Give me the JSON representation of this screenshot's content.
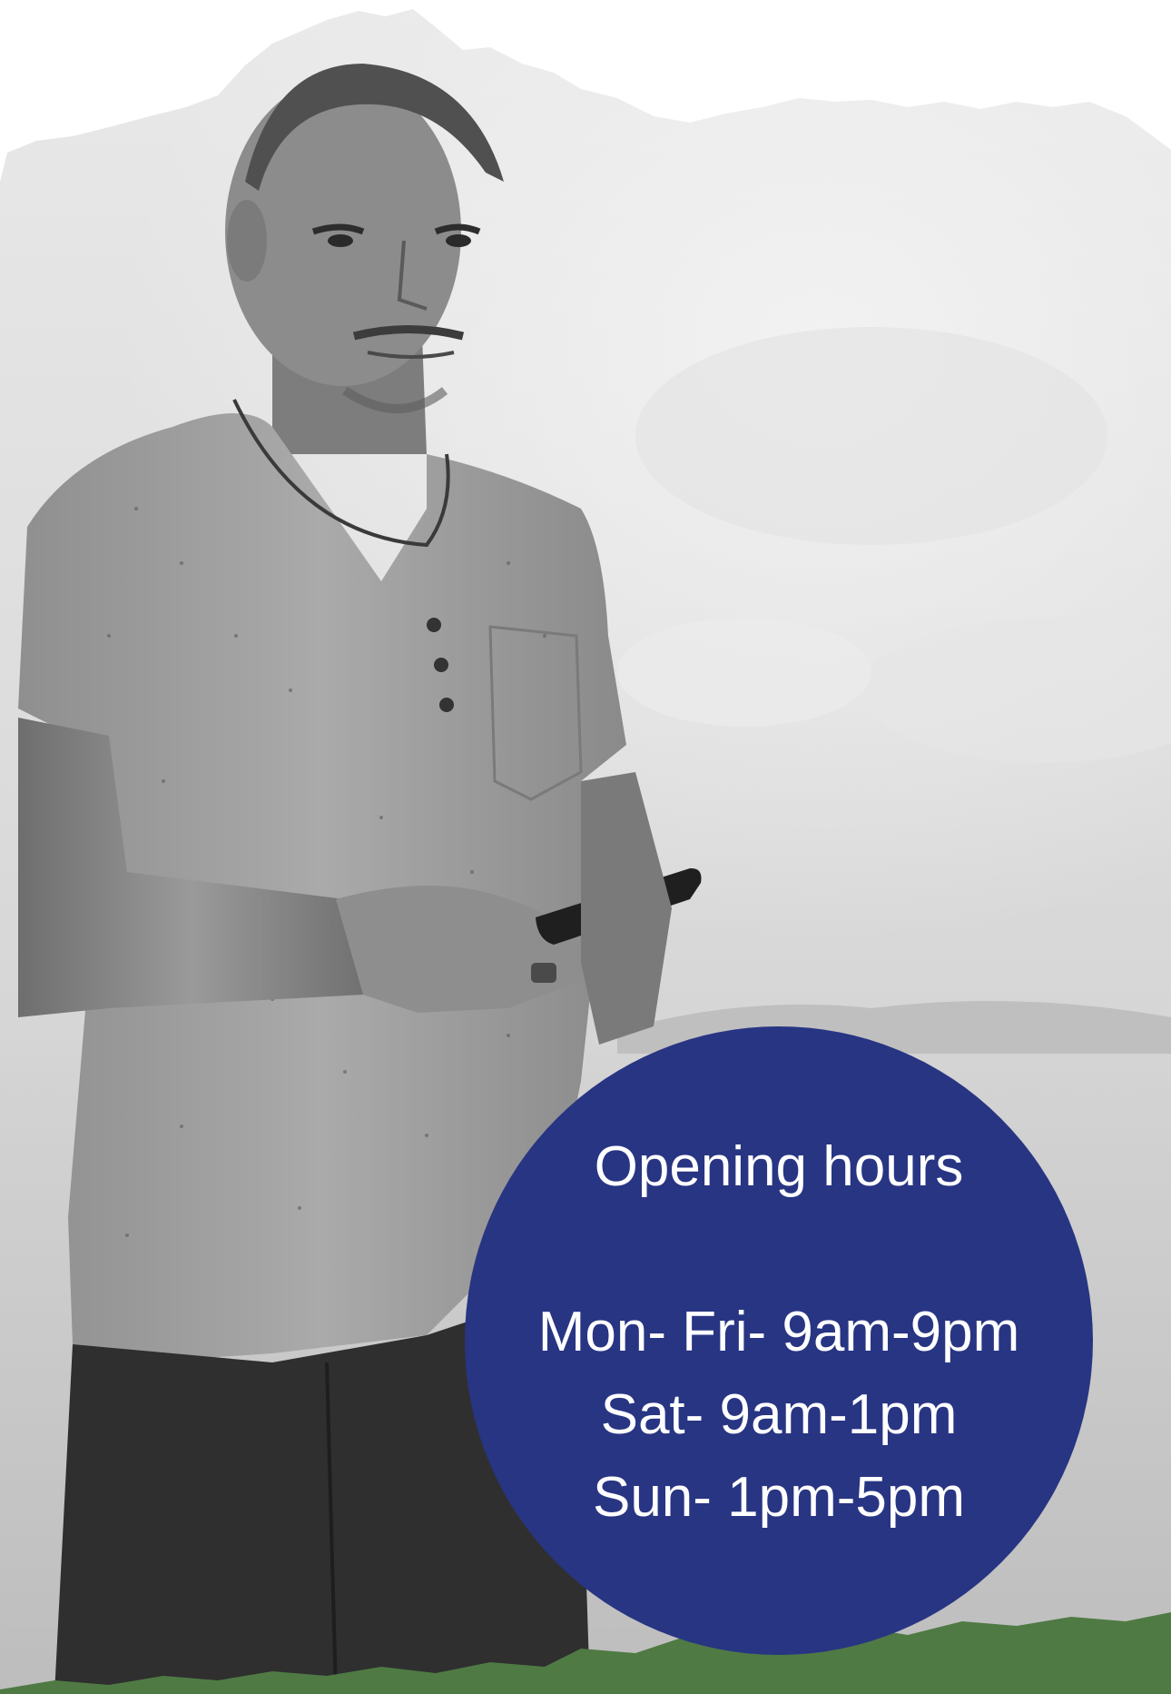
{
  "poster": {
    "title": "Opening hours",
    "hours": [
      "Mon- Fri- 9am-9pm",
      "Sat- 9am-1pm",
      "Sun- 1pm-5pm"
    ]
  },
  "colors": {
    "circle": "#283583",
    "text": "#ffffff",
    "grass": "#4f7a44",
    "photo_tone": "grayscale"
  },
  "photo": {
    "subject": "man in grey t-shirt holding smartphone by the sea"
  }
}
